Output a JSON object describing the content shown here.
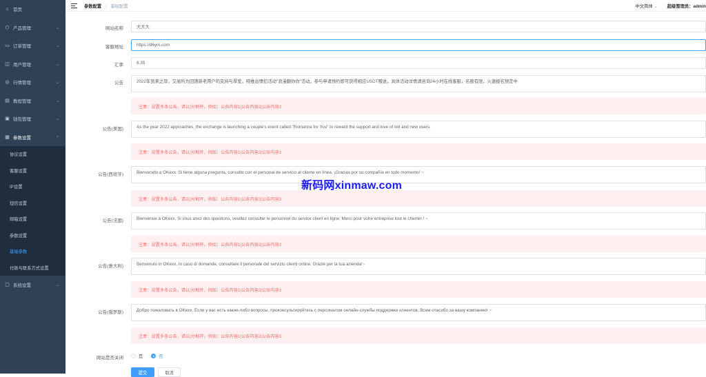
{
  "sidebar": {
    "items": [
      {
        "label": "首页",
        "icon": "home-icon",
        "chevron": false
      },
      {
        "label": "产品管理",
        "icon": "box-icon",
        "chevron": true
      },
      {
        "label": "订单管理",
        "icon": "order-icon",
        "chevron": true
      },
      {
        "label": "用户管理",
        "icon": "user-icon",
        "chevron": true
      },
      {
        "label": "行情管理",
        "icon": "chart-icon",
        "chevron": true
      },
      {
        "label": "教程管理",
        "icon": "book-icon",
        "chevron": true
      },
      {
        "label": "钱包管理",
        "icon": "wallet-icon",
        "chevron": true
      },
      {
        "label": "参数设置",
        "icon": "settings-icon",
        "chevron": true,
        "open": true
      }
    ],
    "submenu": [
      {
        "label": "协议设置"
      },
      {
        "label": "客服设置"
      },
      {
        "label": "IP设置"
      },
      {
        "label": "短信设置"
      },
      {
        "label": "邮箱设置"
      },
      {
        "label": "参数设置"
      },
      {
        "label": "基础参数",
        "active": true
      },
      {
        "label": "付款与联系方式设置"
      }
    ],
    "after": [
      {
        "label": "系统设置",
        "icon": "system-icon",
        "chevron": true
      }
    ]
  },
  "header": {
    "breadcrumb_1": "参数配置",
    "breadcrumb_sep": "/",
    "breadcrumb_2": "基础配置",
    "language": "中文简体",
    "user": "超级管理员：admin"
  },
  "form": {
    "site_name_label": "网站名称",
    "site_name_value": "大大大",
    "service_url_label": "客服地址",
    "service_url_value": "https://d6ym.com",
    "rate_label": "汇率",
    "rate_value": "6.35",
    "notice_label": "公告",
    "notice_value": "2022年到来之际，交易所为回馈新老用户的支持与厚爱，特推出情侣活动\"浪漫翻你你\"活动。参与申请预约即可获得相应USDT赠送，具体活动详情请咨询24小时在线客服，名额有限，火速报名预定中",
    "notice_en_label": "公告(美国)",
    "notice_en_value": "As the year 2022 approaches, the exchange is launching a couple's event called \"Romance for You\" to reward the support and love of old and new users.",
    "notice_es_label": "公告(西班牙)",
    "notice_es_value": "Bienvenido a OKexx. Si tiene alguna pregunta, consulte con el personal de servicio al cliente en línea. ¡Gracias por su compañía en todo momento! ~",
    "notice_fr_label": "公告(法国)",
    "notice_fr_value": "Bienvenue à OKexx. Si vous avez des questions, veuillez consulter le personnel du service client en ligne. Merci pour votre entreprise tout le chemin ! ~",
    "notice_it_label": "公告(意大利)",
    "notice_it_value": "Benvenuto in OKexx. In caso di domande, consultare il personale del servizio clienti online. Grazie per la tua azienda!~",
    "notice_ru_label": "公告(俄罗斯)",
    "notice_ru_value": "Добро пожаловать в OKexx. Если у вас есть какие-либо вопросы, проконсультируйтесь с персоналом онлайн-службы поддержки клиентов. Всем спасибо за вашу компанию! ~",
    "tip": "注意：设置多条公告，请以|分割开，例如：公告内容1|公告内容2|公告内容3",
    "site_closed_label": "网站是否关闭",
    "yes": "是",
    "no": "否",
    "submit": "提交",
    "cancel": "取消"
  },
  "watermark": "新码网xinmaw.com",
  "colors": {
    "sidebar_bg": "#304156",
    "submenu_bg": "#1f2d3d",
    "accent": "#409eff",
    "tip_bg": "#fef0f0",
    "tip_text": "#f56c6c",
    "watermark": "#1a1aff"
  }
}
